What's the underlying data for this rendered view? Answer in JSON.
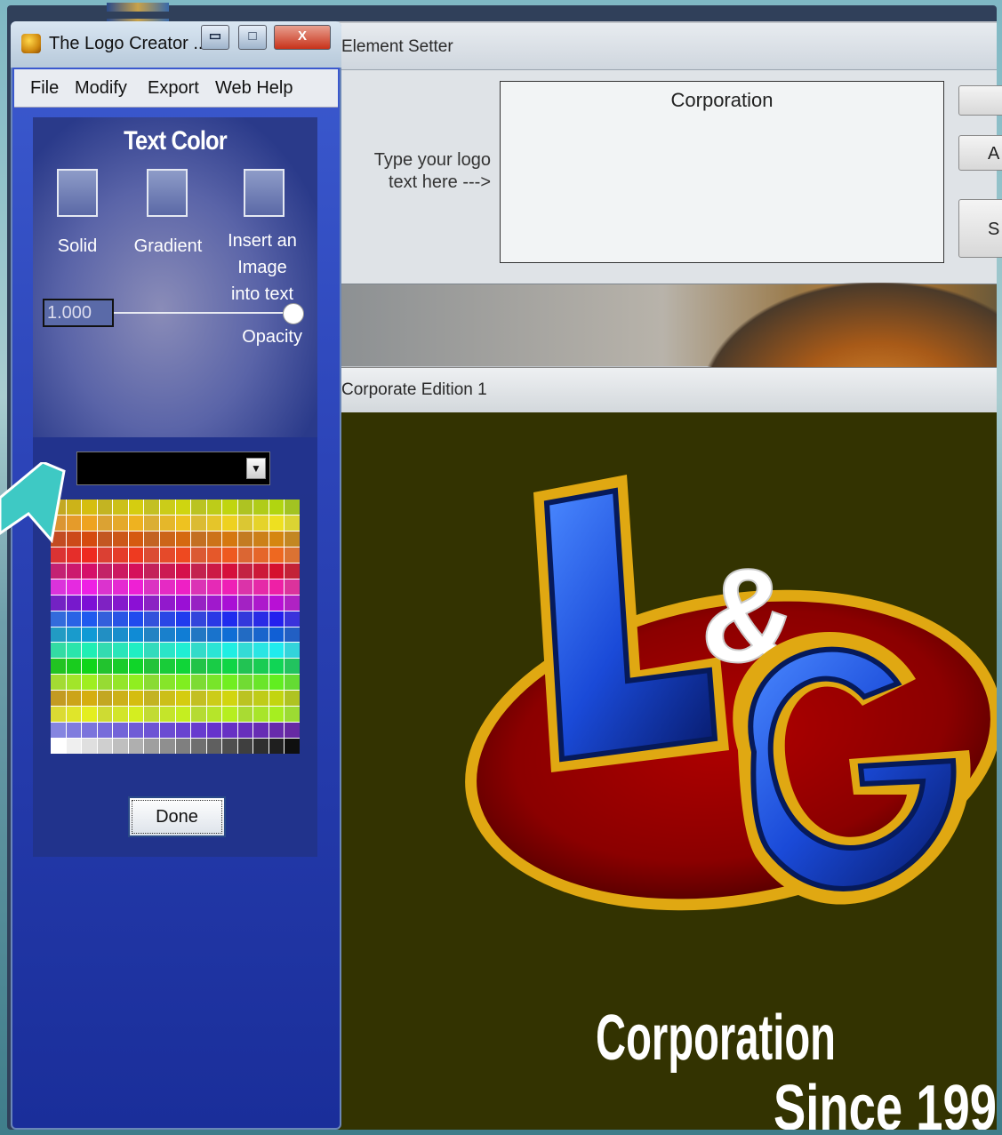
{
  "logo_creator": {
    "title": "The Logo Creator ...",
    "window_controls": {
      "minimize": "▭",
      "maximize": "□",
      "close": "X"
    },
    "menu": [
      "File",
      "Modify",
      "Export",
      "Web Help"
    ],
    "text_color_panel": {
      "heading": "Text Color",
      "options": [
        "Solid",
        "Gradient",
        "Insert an Image into text"
      ],
      "opacity_value": "1.000",
      "opacity_label": "Opacity",
      "opacity_level": 1.0,
      "selected_color": "#000000",
      "done_label": "Done"
    }
  },
  "element_setter": {
    "title": "Element Setter",
    "prompt": "Type your  logo\n text here --->",
    "logo_text": "Corporation",
    "side_buttons": [
      "",
      "A",
      "S"
    ]
  },
  "canvas_window": {
    "title": "Corporate Edition 1",
    "logo_main": "L&G",
    "logo_line1": "Corporation",
    "logo_line2": "Since 199"
  },
  "colors": {
    "panel_blue": "#2c44b8",
    "canvas_bg": "#333301",
    "logo_red": "#8b0000",
    "logo_blue": "#1a4ad8",
    "logo_gold": "#e0a812",
    "arrow_teal": "#3ec9c4"
  }
}
